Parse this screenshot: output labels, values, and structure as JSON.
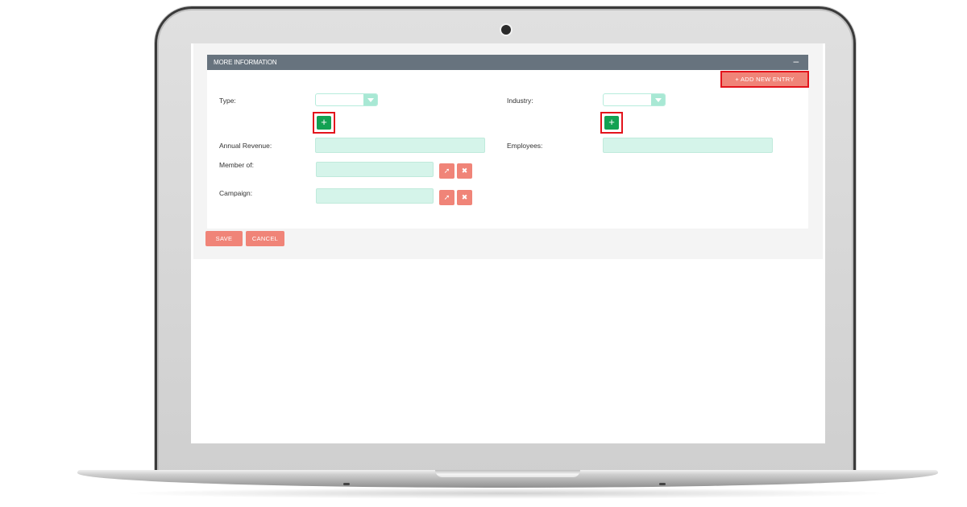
{
  "panel": {
    "title": "MORE INFORMATION",
    "collapse_icon": "minus-icon",
    "collapse_glyph": "–",
    "add_entry_label": "+ ADD NEW ENTRY"
  },
  "fields": {
    "type": {
      "label": "Type:",
      "value": ""
    },
    "industry": {
      "label": "Industry:",
      "value": ""
    },
    "annual_revenue": {
      "label": "Annual Revenue:",
      "value": ""
    },
    "employees": {
      "label": "Employees:",
      "value": ""
    },
    "member_of": {
      "label": "Member of:",
      "value": ""
    },
    "campaign": {
      "label": "Campaign:",
      "value": ""
    }
  },
  "icons": {
    "plus_glyph": "+",
    "select_glyph": "➚",
    "clear_glyph": "✖"
  },
  "actions": {
    "save_label": "SAVE",
    "cancel_label": "CANCEL"
  },
  "colors": {
    "header": "#67737e",
    "accent_button": "#f08478",
    "highlight_border": "#e3141c",
    "add_green": "#12a152",
    "input_bg": "#d5f4ea"
  }
}
